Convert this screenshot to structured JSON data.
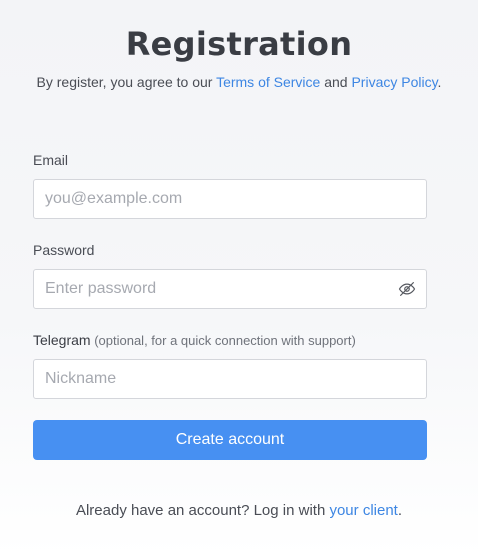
{
  "header": {
    "title": "Registration",
    "agreement_prefix": "By register, you agree to our ",
    "terms_link": "Terms of Service",
    "agreement_and": " and ",
    "privacy_link": "Privacy Policy",
    "agreement_suffix": "."
  },
  "form": {
    "email": {
      "label": "Email",
      "value": "",
      "placeholder": "you@example.com"
    },
    "password": {
      "label": "Password",
      "value": "",
      "placeholder": "Enter password",
      "toggle_icon": "eye-slash-icon"
    },
    "telegram": {
      "label": "Telegram",
      "hint": " (optional, for a quick connection with support)",
      "value": "",
      "placeholder": "Nickname"
    },
    "submit_label": "Create account"
  },
  "footer": {
    "prefix": "Already have an account? Log in with ",
    "link": "your client",
    "suffix": "."
  },
  "colors": {
    "accent": "#4790f2",
    "link": "#3d86e3",
    "text": "#3a3d44",
    "border": "#d4d6db"
  }
}
